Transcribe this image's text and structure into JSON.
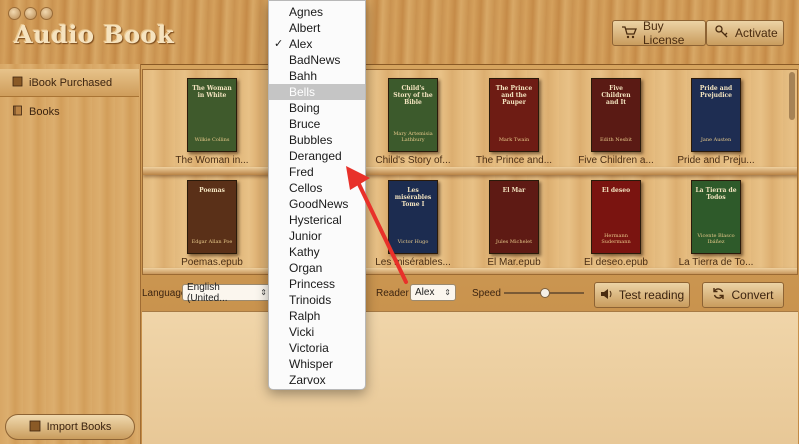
{
  "app": {
    "title": "Audio Book"
  },
  "header": {
    "buy_label": "Buy License",
    "activate_label": "Activate"
  },
  "sidebar": {
    "items": [
      {
        "label": "iBook Purchased"
      },
      {
        "label": "Books"
      }
    ],
    "import_label": "Import Books"
  },
  "shelves": {
    "row1": [
      {
        "title": "The Woman in White",
        "author": "Wilkie Collins",
        "caption": "The Woman in...",
        "color": "#3f5a2c"
      },
      {
        "title": "Child's Story of the Bible",
        "author": "Mary Artemisia Lathbury",
        "caption": "Child's Story of...",
        "color": "#3c5a2c"
      },
      {
        "title": "The Prince and the Pauper",
        "author": "Mark Twain",
        "caption": "The Prince and...",
        "color": "#6e1c14"
      },
      {
        "title": "Five Children and It",
        "author": "Edith Nesbit",
        "caption": "Five Children a...",
        "color": "#5a1a14"
      },
      {
        "title": "Pride and Prejudice",
        "author": "Jane Austen",
        "caption": "Pride and Preju...",
        "color": "#1e2d52"
      }
    ],
    "row2": [
      {
        "title": "Poemas",
        "author": "Edgar Allan Poe",
        "caption": "Poemas.epub",
        "color": "#5a3018"
      },
      {
        "title": "Les misérables Tome I",
        "author": "Victor Hugo",
        "caption": "Les misérables...",
        "color": "#1c2c50"
      },
      {
        "title": "El Mar",
        "author": "Jules Michelet",
        "caption": "El Mar.epub",
        "color": "#5e1a14"
      },
      {
        "title": "El deseo",
        "author": "Hermann Sudermann",
        "caption": "El deseo.epub",
        "color": "#7a1410"
      },
      {
        "title": "La Tierra de Todos",
        "author": "Vicente Blasco Ibáñez",
        "caption": "La Tierra de To...",
        "color": "#2e5a2a"
      }
    ]
  },
  "controls": {
    "language_label": "Language",
    "language_value": "English (United...",
    "reader_label": "Reader",
    "reader_value": "Alex",
    "speed_label": "Speed",
    "speed_value": 0.5,
    "test_label": "Test reading",
    "convert_label": "Convert"
  },
  "voice_menu": {
    "selected": "Alex",
    "highlighted": "Bells",
    "items": [
      "Agnes",
      "Albert",
      "Alex",
      "BadNews",
      "Bahh",
      "Bells",
      "Boing",
      "Bruce",
      "Bubbles",
      "Deranged",
      "Fred",
      "Cellos",
      "GoodNews",
      "Hysterical",
      "Junior",
      "Kathy",
      "Organ",
      "Princess",
      "Trinoids",
      "Ralph",
      "Vicki",
      "Victoria",
      "Whisper",
      "Zarvox"
    ],
    "check_mark": "✓"
  },
  "colors": {
    "annotation_arrow": "#e8312a",
    "menu_highlight": "#c5c5c5"
  }
}
